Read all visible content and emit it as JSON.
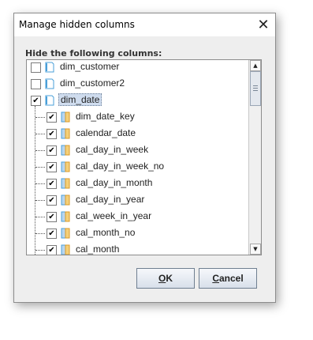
{
  "window": {
    "title": "Manage hidden columns",
    "close_glyph": "✕"
  },
  "prompt": "Hide the following columns:",
  "tables": [
    {
      "name": "dim_customer",
      "checked": false
    },
    {
      "name": "dim_customer2",
      "checked": false
    },
    {
      "name": "dim_date",
      "checked": true,
      "selected": true
    }
  ],
  "columns": [
    {
      "name": "dim_date_key",
      "checked": true
    },
    {
      "name": "calendar_date",
      "checked": true
    },
    {
      "name": "cal_day_in_week",
      "checked": true
    },
    {
      "name": "cal_day_in_week_no",
      "checked": true
    },
    {
      "name": "cal_day_in_month",
      "checked": true
    },
    {
      "name": "cal_day_in_year",
      "checked": true
    },
    {
      "name": "cal_week_in_year",
      "checked": true
    },
    {
      "name": "cal_month_no",
      "checked": true
    },
    {
      "name": "cal_month",
      "checked": true
    }
  ],
  "check_glyph": "✔",
  "buttons": {
    "ok": {
      "accel": "O",
      "rest": "K"
    },
    "cancel": {
      "accel": "C",
      "rest": "ancel"
    }
  },
  "colors": {
    "selection": "#cfdcee",
    "table_icon": "#4a9fd8",
    "column_icon": "#e8b84a"
  }
}
